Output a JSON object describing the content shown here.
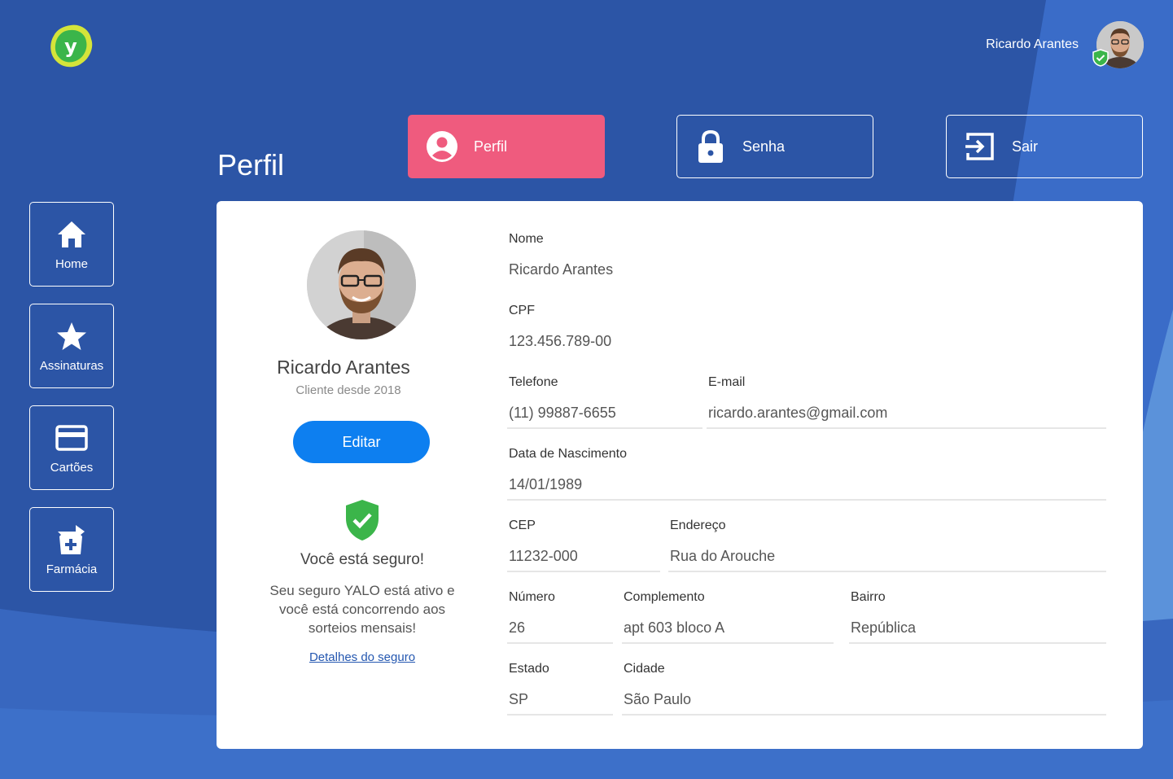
{
  "colors": {
    "background": "#2c55a6",
    "accent_pink": "#ef5b7e",
    "primary_blue": "#0d7ff0",
    "success_green": "#3bb54a",
    "logo_yellow": "#d4e43a"
  },
  "header": {
    "user_name": "Ricardo Arantes",
    "logo_icon": "yalo-logo-icon",
    "avatar_icon": "avatar-icon"
  },
  "page": {
    "title": "Perfil"
  },
  "tabs": [
    {
      "label": "Perfil",
      "icon": "user-icon",
      "active": true
    },
    {
      "label": "Senha",
      "icon": "lock-icon",
      "active": false
    },
    {
      "label": "Sair",
      "icon": "logout-icon",
      "active": false
    }
  ],
  "sidebar": {
    "items": [
      {
        "label": "Home",
        "icon": "home-icon"
      },
      {
        "label": "Assinaturas",
        "icon": "star-icon"
      },
      {
        "label": "Cartões",
        "icon": "credit-card-icon"
      },
      {
        "label": "Farmácia",
        "icon": "pharmacy-icon"
      }
    ]
  },
  "profile": {
    "name": "Ricardo Arantes",
    "since": "Cliente desde 2018",
    "edit_label": "Editar",
    "secure_title": "Você está seguro!",
    "secure_desc": "Seu seguro YALO está ativo e você está concorrendo aos sorteios mensais!",
    "secure_link": "Detalhes do seguro"
  },
  "form": {
    "nome": {
      "label": "Nome",
      "value": "Ricardo Arantes"
    },
    "cpf": {
      "label": "CPF",
      "value": "123.456.789-00"
    },
    "telefone": {
      "label": "Telefone",
      "value": "(11) 99887-6655"
    },
    "email": {
      "label": "E-mail",
      "value": "ricardo.arantes@gmail.com"
    },
    "nascimento": {
      "label": "Data de Nascimento",
      "value": "14/01/1989"
    },
    "cep": {
      "label": "CEP",
      "value": "11232-000"
    },
    "endereco": {
      "label": "Endereço",
      "value": "Rua do Arouche"
    },
    "numero": {
      "label": "Número",
      "value": "26"
    },
    "complemento": {
      "label": "Complemento",
      "value": "apt 603 bloco A"
    },
    "bairro": {
      "label": "Bairro",
      "value": "República"
    },
    "estado": {
      "label": "Estado",
      "value": "SP"
    },
    "cidade": {
      "label": "Cidade",
      "value": "São Paulo"
    }
  }
}
